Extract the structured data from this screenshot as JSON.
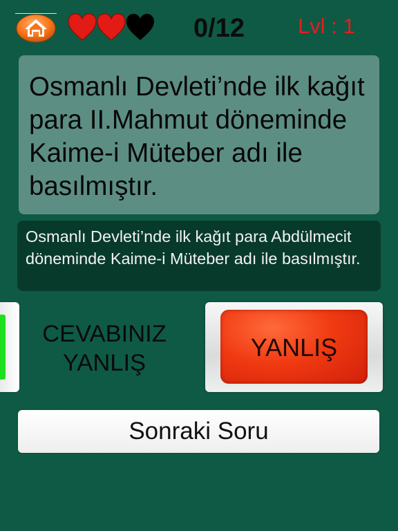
{
  "header": {
    "lives": [
      {
        "state": "full",
        "color": "#e21b14"
      },
      {
        "state": "full",
        "color": "#e21b14"
      },
      {
        "state": "empty",
        "color": "#000000"
      }
    ],
    "score": "0/12",
    "level": "Lvl : 1"
  },
  "question": {
    "text": "Osmanlı Devleti’nde ilk kağıt para II.Mahmut döneminde Kaime-i Müteber adı ile basılmıştır."
  },
  "correct_answer": {
    "text": "Osmanlı Devleti’nde ilk kağıt para Abdülmecit döneminde Kaime-i Müteber adı ile basılmıştır."
  },
  "result": {
    "text": "CEVABINIZ YANLIŞ"
  },
  "buttons": {
    "false_label": "YANLIŞ",
    "next_label": "Sonraki Soru"
  },
  "colors": {
    "background": "#0f5a45",
    "question_card": "#5d8e83",
    "answer_card": "#083a2c",
    "level_text": "#e31e1e",
    "false_button": "#f03a12",
    "true_button_edge": "#1ee01e"
  }
}
